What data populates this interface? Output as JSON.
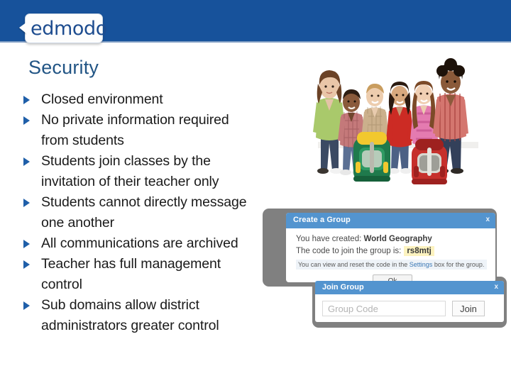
{
  "header": {
    "logo_text": "edmodo",
    "band_color": "#17529B"
  },
  "slide": {
    "title": "Security",
    "title_color": "#225585",
    "bullets": [
      {
        "lines": [
          "Closed environment"
        ]
      },
      {
        "lines": [
          "No private information required",
          "from students"
        ]
      },
      {
        "lines": [
          "Students join classes by the",
          "invitation of their teacher only"
        ]
      },
      {
        "lines": [
          "Students cannot directly message",
          "one another"
        ]
      },
      {
        "lines": [
          "All communications are archived"
        ]
      },
      {
        "lines": [
          "Teacher has full management",
          "control"
        ]
      },
      {
        "lines": [
          "Sub domains allow district",
          "administrators greater control"
        ]
      }
    ]
  },
  "photo": {
    "alt": "Teacher and five students seated with backpacks"
  },
  "create_group_dialog": {
    "title": "Create a Group",
    "close_label": "x",
    "line1_prefix": "You have created:",
    "group_name": "World Geography",
    "line2_prefix": "The code to join the group is:",
    "group_code": "rs8mtj",
    "note_before": "You can view and reset the code in the ",
    "note_link": "Settings",
    "note_after": " box for the group.",
    "ok_label": "Ok",
    "title_bar_color": "#5394cf",
    "code_highlight_color": "#fdf3bf"
  },
  "join_group_dialog": {
    "title": "Join Group",
    "close_label": "x",
    "input_placeholder": "Group Code",
    "input_value": "",
    "join_label": "Join",
    "title_bar_color": "#5394cf"
  }
}
